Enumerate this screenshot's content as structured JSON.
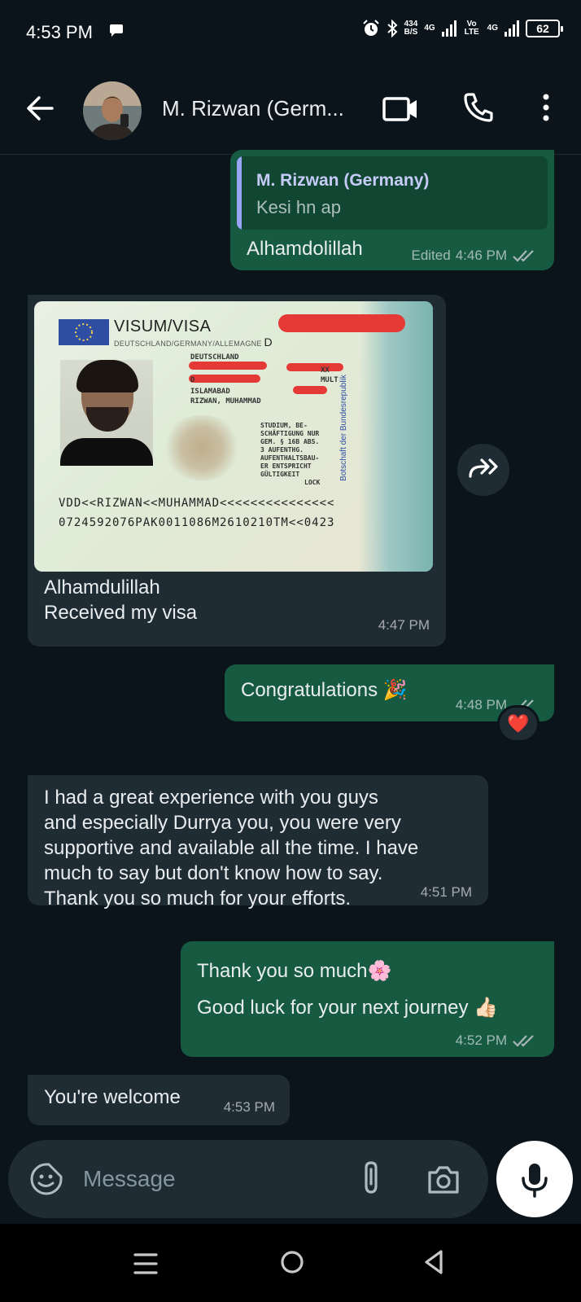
{
  "status_bar": {
    "time": "4:53 PM",
    "net_speed_value": "434",
    "net_speed_unit": "B/S",
    "net_label_1": "4G",
    "volte_label": "Vo LTE",
    "net_label_2": "4G",
    "battery": "62"
  },
  "header": {
    "contact_name": "M. Rizwan (Germ..."
  },
  "messages": [
    {
      "direction": "out",
      "quote_name": "M. Rizwan (Germany)",
      "quote_text": "Kesi hn ap",
      "text": "Alhamdolillah",
      "edited": "Edited",
      "time": "4:46 PM"
    },
    {
      "direction": "in",
      "image": {
        "visa_title": "VISUM/VISA",
        "visa_sub": "DEUTSCHLAND/GERMANY/ALLEMAGNE",
        "visa_letter": "D",
        "country": "DEUTSCHLAND",
        "type": "D",
        "city": "ISLAMABAD",
        "holder": "RIZWAN, MUHAMMAD",
        "entries": "MULT",
        "xx": "XX",
        "remark_1": "STUDIUM, BE-",
        "remark_2": "SCHÄFTIGUNG NUR",
        "remark_3": "GEM. § 16B ABS.",
        "remark_4": "3 AUFENTHG.",
        "remark_5": "AUFENTHALTSBAU-",
        "remark_6": "ER ENTSPRICHT",
        "remark_7": "GÜLTIGKEIT",
        "issuer": "Botschaft der Bundesrepublik",
        "lock": "LOCK",
        "mrz_1": "VDD<<RIZWAN<<MUHAMMAD<<<<<<<<<<<<<<<",
        "mrz_2": "0724592076PAK0011086M2610210TM<<0423"
      },
      "text_line_1": "Alhamdulillah",
      "text_line_2": "Received my visa",
      "time": "4:47 PM"
    },
    {
      "direction": "out",
      "text": "Congratulations 🎉",
      "time": "4:48 PM",
      "reaction": "❤️"
    },
    {
      "direction": "in",
      "lines": [
        "I had a great experience with you guys",
        "and especially Durrya you, you were very",
        "supportive and available all the time. I have",
        "much to say but don't know how to say.",
        "Thank you so much for your efforts."
      ],
      "time": "4:51 PM"
    },
    {
      "direction": "out",
      "text_line_1": "Thank you so much🌸",
      "text_line_2": "Good luck for your next journey 👍🏻",
      "time": "4:52 PM"
    },
    {
      "direction": "in",
      "text": "You're welcome",
      "time": "4:53 PM"
    }
  ],
  "composer": {
    "placeholder": "Message"
  },
  "icons": {
    "back": "arrow-left-icon",
    "video": "video-camera-icon",
    "call": "phone-icon",
    "menu": "more-vertical-icon",
    "forward": "forward-icon",
    "sticker": "sticker-icon",
    "attach": "paperclip-icon",
    "camera": "camera-icon",
    "mic": "microphone-icon"
  },
  "colors": {
    "background": "#0b141a",
    "outgoing_bubble": "#165a42",
    "incoming_bubble": "#202c33",
    "tick": "#9aa6a8"
  }
}
